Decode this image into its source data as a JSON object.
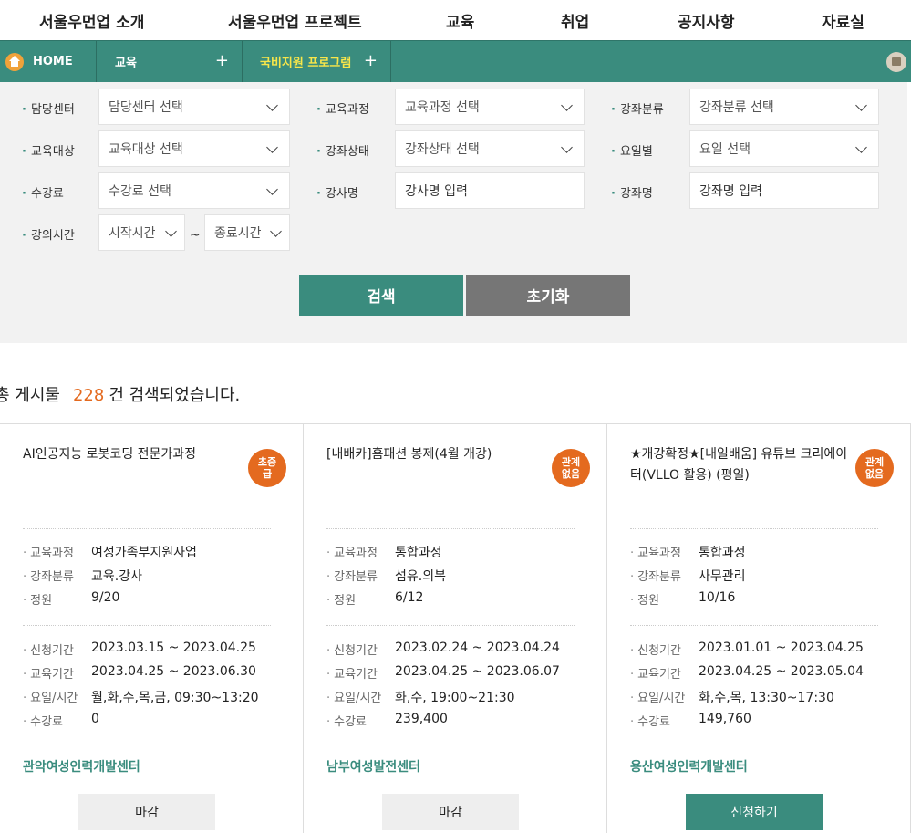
{
  "nav": [
    "서울우먼업 소개",
    "서울우먼업 프로젝트",
    "교육",
    "취업",
    "공지사항",
    "자료실"
  ],
  "breadcrumb": {
    "home": "HOME",
    "level1": "교육",
    "level2": "국비지원 프로그램"
  },
  "colors": {
    "primary": "#3a8c7e",
    "accent": "#e46a1f",
    "highlight": "#f7e64a",
    "reset": "#767676"
  },
  "filters": {
    "center": {
      "label": "담당센터",
      "value": "담당센터 선택"
    },
    "course": {
      "label": "교육과정",
      "value": "교육과정 선택"
    },
    "category": {
      "label": "강좌분류",
      "value": "강좌분류 선택"
    },
    "target": {
      "label": "교육대상",
      "value": "교육대상 선택"
    },
    "status": {
      "label": "강좌상태",
      "value": "강좌상태 선택"
    },
    "day": {
      "label": "요일별",
      "value": "요일 선택"
    },
    "fee": {
      "label": "수강료",
      "value": "수강료 선택"
    },
    "instructor": {
      "label": "강사명",
      "placeholder": "강사명 입력"
    },
    "lecture": {
      "label": "강좌명",
      "placeholder": "강좌명 입력"
    },
    "time": {
      "label": "강의시간",
      "start": "시작시간",
      "tilde": "~",
      "end": "종료시간"
    }
  },
  "buttons": {
    "search": "검색",
    "reset": "초기화"
  },
  "result": {
    "prefix": "총 게시물",
    "count": "228",
    "suffix": "건 검색되었습니다."
  },
  "cards": [
    {
      "title": "AI인공지능 로봇코딩 전문가과정",
      "badge": "초중급",
      "course_label": "교육과정",
      "course": "여성가족부지원사업",
      "category_label": "강좌분류",
      "category": "교육.강사",
      "capacity_label": "정원",
      "capacity": "9/20",
      "apply_label": "신청기간",
      "apply_period": "2023.03.15 ~ 2023.04.25",
      "edu_label": "교육기간",
      "edu_period": "2023.04.25 ~ 2023.06.30",
      "schedule_label": "요일/시간",
      "schedule": "월,화,수,목,금, 09:30~13:20",
      "fee_label": "수강료",
      "fee": "0",
      "center": "관악여성인력개발센터",
      "button": "마감"
    },
    {
      "title": "[내배카]홈패션 봉제(4월 개강)",
      "badge": "관계없음",
      "course_label": "교육과정",
      "course": "통합과정",
      "category_label": "강좌분류",
      "category": "섬유.의복",
      "capacity_label": "정원",
      "capacity": "6/12",
      "apply_label": "신청기간",
      "apply_period": "2023.02.24 ~ 2023.04.24",
      "edu_label": "교육기간",
      "edu_period": "2023.04.25 ~ 2023.06.07",
      "schedule_label": "요일/시간",
      "schedule": "화,수, 19:00~21:30",
      "fee_label": "수강료",
      "fee": "239,400",
      "center": "남부여성발전센터",
      "button": "마감"
    },
    {
      "title": "★개강확정★[내일배움] 유튜브 크리에이터(VLLO 활용) (평일)",
      "badge": "관계없음",
      "course_label": "교육과정",
      "course": "통합과정",
      "category_label": "강좌분류",
      "category": "사무관리",
      "capacity_label": "정원",
      "capacity": "10/16",
      "apply_label": "신청기간",
      "apply_period": "2023.01.01 ~ 2023.04.25",
      "edu_label": "교육기간",
      "edu_period": "2023.04.25 ~ 2023.05.04",
      "schedule_label": "요일/시간",
      "schedule": "화,수,목, 13:30~17:30",
      "fee_label": "수강료",
      "fee": "149,760",
      "center": "용산여성인력개발센터",
      "button": "신청하기"
    }
  ]
}
